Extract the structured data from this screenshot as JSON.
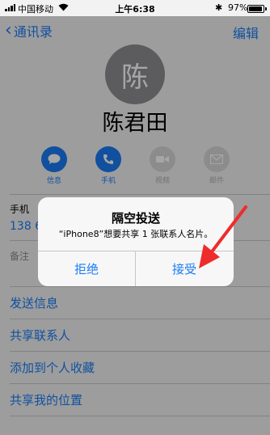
{
  "status_bar": {
    "carrier": "中国移动",
    "time": "上午6:38",
    "battery": "97%"
  },
  "nav": {
    "back_label": "通讯录",
    "edit_label": "编辑"
  },
  "contact": {
    "avatar_char": "陈",
    "name": "陈君田"
  },
  "actions": [
    {
      "label": "信息",
      "icon": "message-icon",
      "enabled": true
    },
    {
      "label": "手机",
      "icon": "phone-icon",
      "enabled": true
    },
    {
      "label": "视频",
      "icon": "video-icon",
      "enabled": false
    },
    {
      "label": "邮件",
      "icon": "mail-icon",
      "enabled": false
    }
  ],
  "details": {
    "phone_label": "手机",
    "phone_value": "138 6",
    "notes_label": "备注"
  },
  "links": [
    "发送信息",
    "共享联系人",
    "添加到个人收藏",
    "共享我的位置"
  ],
  "alert": {
    "title": "隔空投送",
    "message": "“iPhone8”想要共享 1 张联系人名片。",
    "decline": "拒绝",
    "accept": "接受"
  },
  "colors": {
    "accent": "#1a7cf5",
    "arrow": "#ee2c2c"
  }
}
